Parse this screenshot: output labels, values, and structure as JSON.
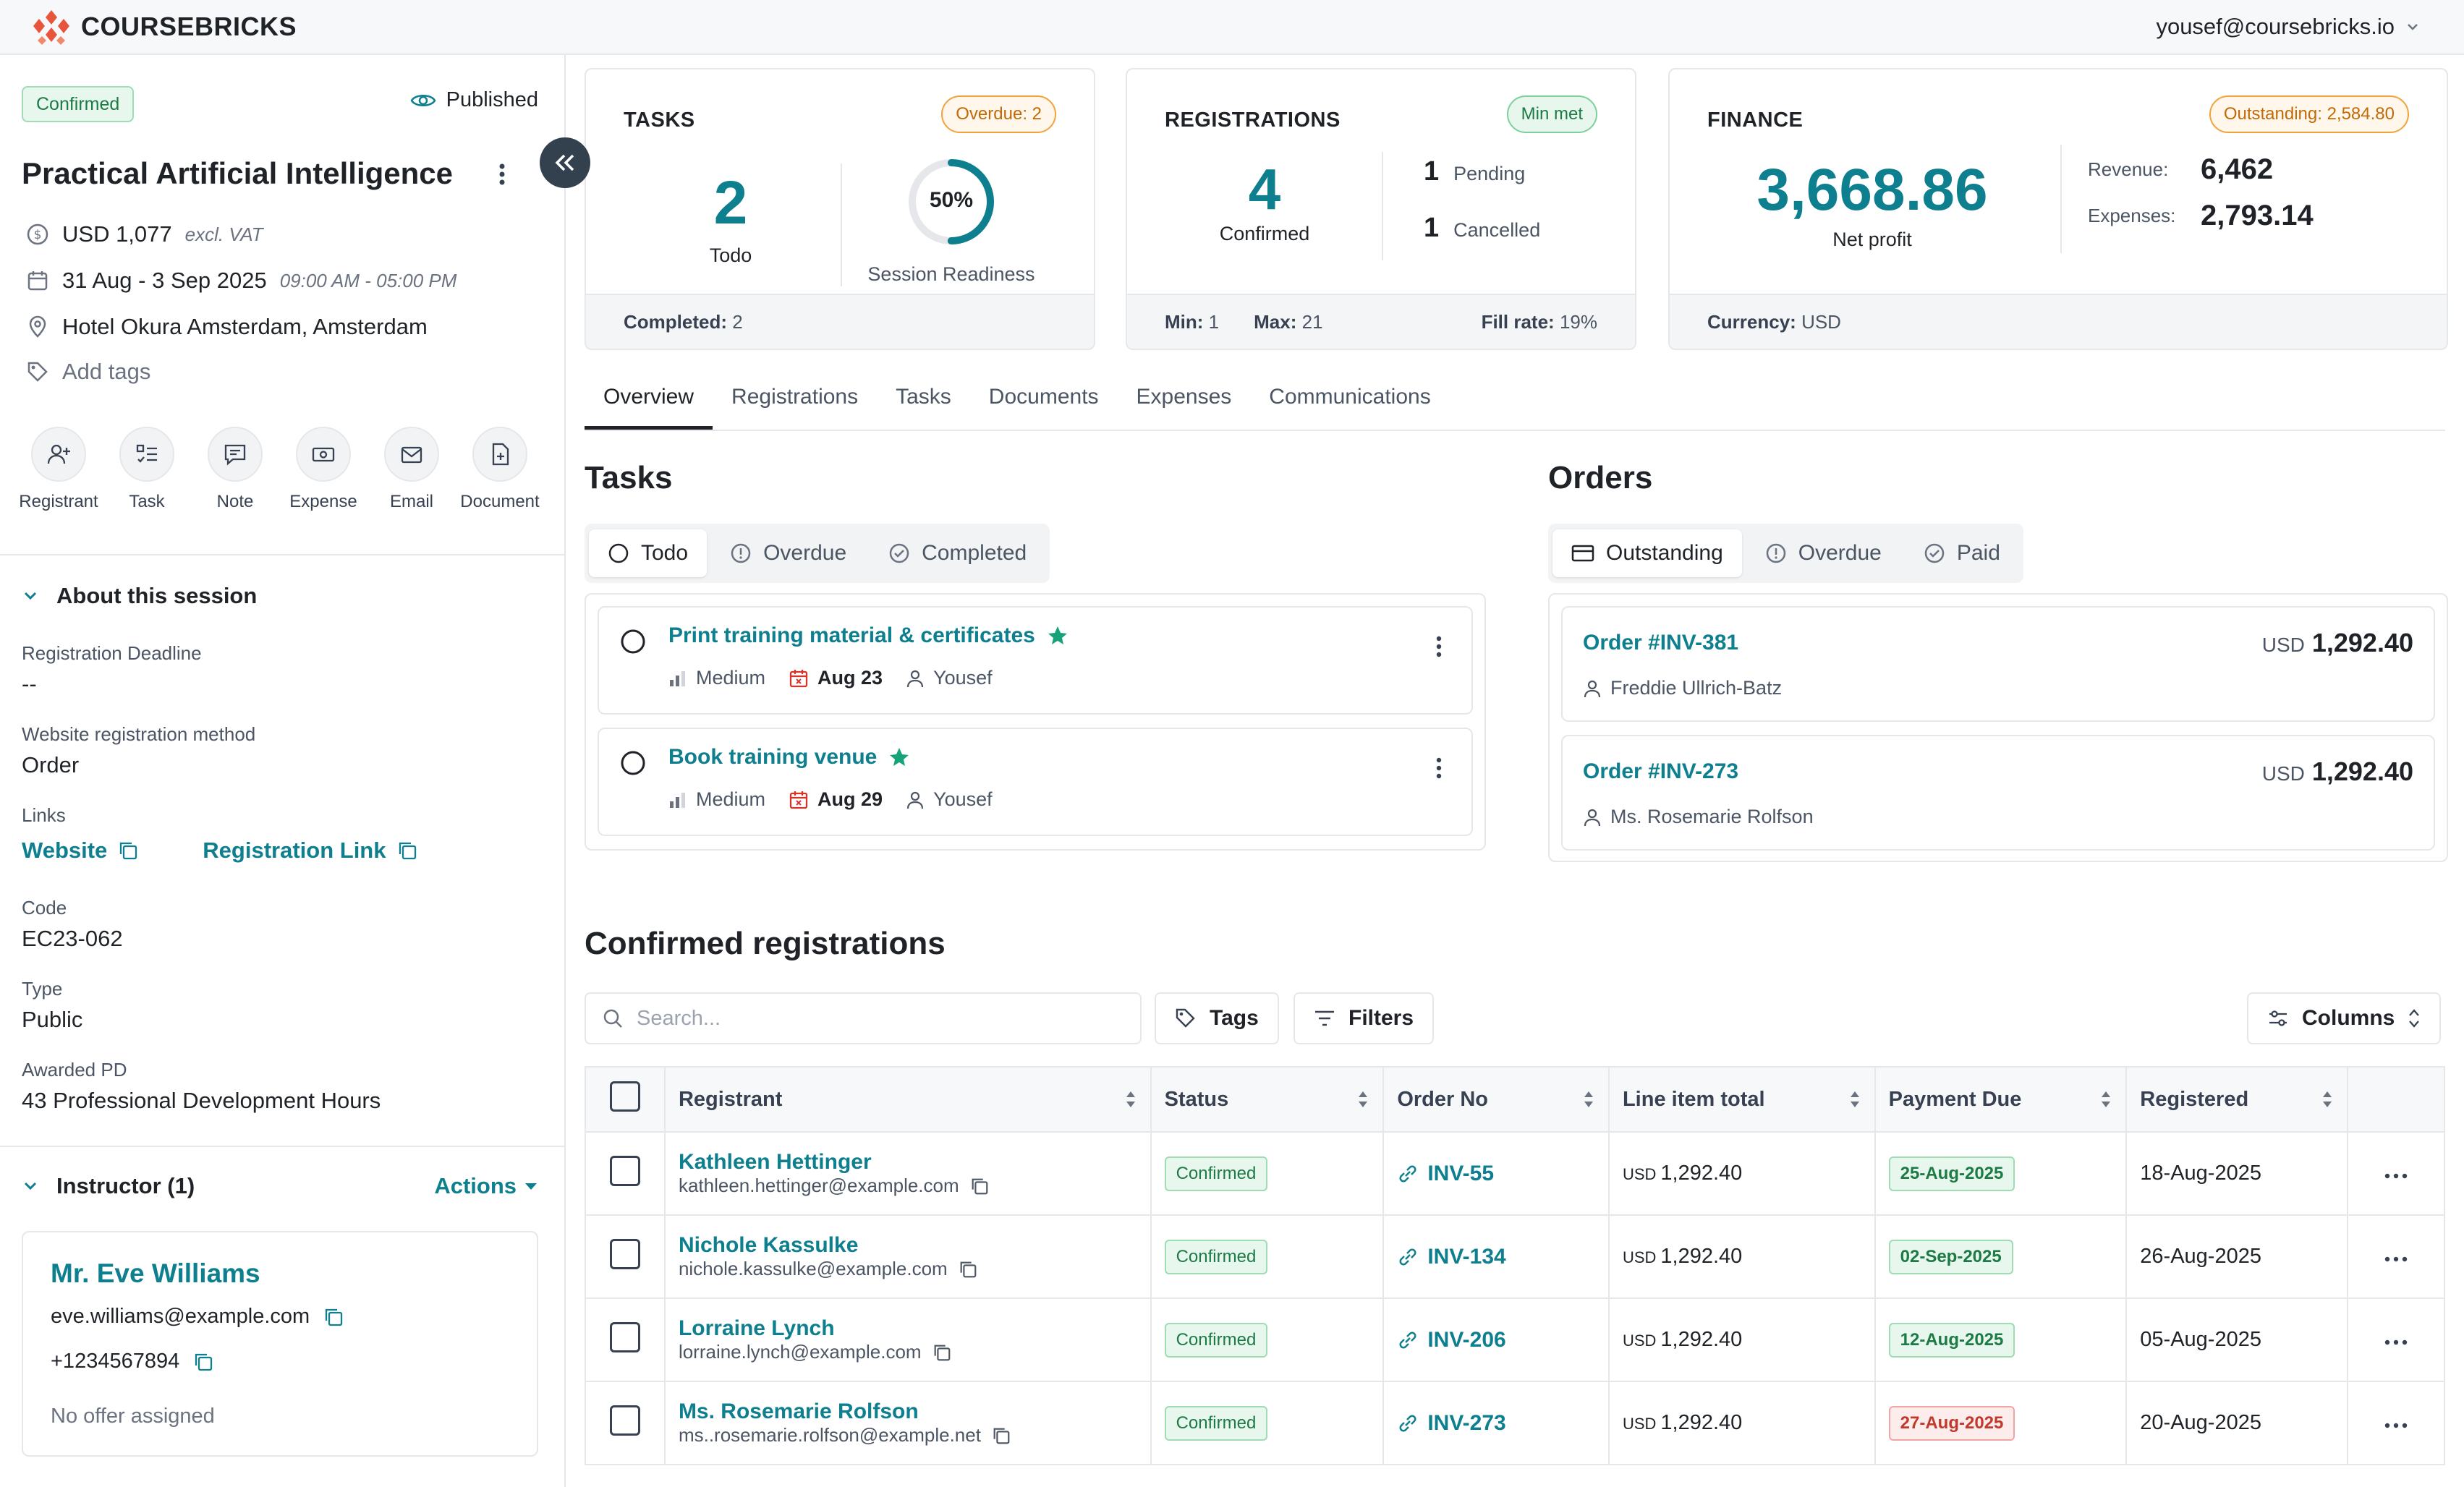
{
  "header": {
    "brand": "COURSEBRICKS",
    "user_email": "yousef@coursebricks.io"
  },
  "session": {
    "status_badge": "Confirmed",
    "published_label": "Published",
    "title": "Practical Artificial Intelligence",
    "price": "USD 1,077",
    "price_note": "excl. VAT",
    "dates": "31 Aug - 3 Sep 2025",
    "times": "09:00 AM - 05:00 PM",
    "location": "Hotel Okura Amsterdam, Amsterdam",
    "add_tags": "Add tags"
  },
  "quick_actions": [
    "Registrant",
    "Task",
    "Note",
    "Expense",
    "Email",
    "Document"
  ],
  "about": {
    "heading": "About this session",
    "deadline_label": "Registration Deadline",
    "deadline_value": "--",
    "method_label": "Website registration method",
    "method_value": "Order",
    "links_label": "Links",
    "link_website": "Website",
    "link_registration": "Registration Link",
    "code_label": "Code",
    "code_value": "EC23-062",
    "type_label": "Type",
    "type_value": "Public",
    "pd_label": "Awarded PD",
    "pd_value": "43 Professional Development Hours"
  },
  "instructor": {
    "heading": "Instructor (1)",
    "actions": "Actions",
    "name": "Mr. Eve Williams",
    "email": "eve.williams@example.com",
    "phone": "+1234567894",
    "note": "No offer assigned"
  },
  "cards": {
    "tasks": {
      "title": "TASKS",
      "pill": "Overdue: 2",
      "todo_count": "2",
      "todo_label": "Todo",
      "readiness_percent": 50,
      "readiness_text": "50%",
      "readiness_label": "Session Readiness",
      "footer_label": "Completed:",
      "footer_value": "2"
    },
    "registrations": {
      "title": "REGISTRATIONS",
      "pill": "Min met",
      "confirmed_count": "4",
      "confirmed_label": "Confirmed",
      "pending_count": "1",
      "pending_label": "Pending",
      "cancelled_count": "1",
      "cancelled_label": "Cancelled",
      "min_label": "Min:",
      "min_value": "1",
      "max_label": "Max:",
      "max_value": "21",
      "fill_label": "Fill rate:",
      "fill_value": "19%"
    },
    "finance": {
      "title": "FINANCE",
      "pill": "Outstanding: 2,584.80",
      "net_profit": "3,668.86",
      "net_profit_label": "Net profit",
      "revenue_label": "Revenue:",
      "revenue_value": "6,462",
      "expenses_label": "Expenses:",
      "expenses_value": "2,793.14",
      "currency_label": "Currency:",
      "currency_value": "USD"
    }
  },
  "tabs": [
    "Overview",
    "Registrations",
    "Tasks",
    "Documents",
    "Expenses",
    "Communications"
  ],
  "tasks_section": {
    "heading": "Tasks",
    "filters": [
      "Todo",
      "Overdue",
      "Completed"
    ],
    "items": [
      {
        "title": "Print training material & certificates",
        "priority": "Medium",
        "due": "Aug 23",
        "assignee": "Yousef"
      },
      {
        "title": "Book training venue",
        "priority": "Medium",
        "due": "Aug 29",
        "assignee": "Yousef"
      }
    ]
  },
  "orders_section": {
    "heading": "Orders",
    "filters": [
      "Outstanding",
      "Overdue",
      "Paid"
    ],
    "items": [
      {
        "order_no": "Order #INV-381",
        "currency": "USD",
        "amount": "1,292.40",
        "person": "Freddie Ullrich-Batz"
      },
      {
        "order_no": "Order #INV-273",
        "currency": "USD",
        "amount": "1,292.40",
        "person": "Ms. Rosemarie Rolfson"
      }
    ]
  },
  "registrations_section": {
    "heading": "Confirmed registrations",
    "search_placeholder": "Search...",
    "tags_btn": "Tags",
    "filters_btn": "Filters",
    "columns_btn": "Columns",
    "columns": [
      "Registrant",
      "Status",
      "Order No",
      "Line item total",
      "Payment Due",
      "Registered"
    ],
    "rows": [
      {
        "name": "Kathleen Hettinger",
        "email": "kathleen.hettinger@example.com",
        "status": "Confirmed",
        "order": "INV-55",
        "currency": "USD",
        "total": "1,292.40",
        "due": "25-Aug-2025",
        "due_state": "green",
        "registered": "18-Aug-2025"
      },
      {
        "name": "Nichole Kassulke",
        "email": "nichole.kassulke@example.com",
        "status": "Confirmed",
        "order": "INV-134",
        "currency": "USD",
        "total": "1,292.40",
        "due": "02-Sep-2025",
        "due_state": "green",
        "registered": "26-Aug-2025"
      },
      {
        "name": "Lorraine Lynch",
        "email": "lorraine.lynch@example.com",
        "status": "Confirmed",
        "order": "INV-206",
        "currency": "USD",
        "total": "1,292.40",
        "due": "12-Aug-2025",
        "due_state": "green",
        "registered": "05-Aug-2025"
      },
      {
        "name": "Ms. Rosemarie Rolfson",
        "email": "ms..rosemarie.rolfson@example.net",
        "status": "Confirmed",
        "order": "INV-273",
        "currency": "USD",
        "total": "1,292.40",
        "due": "27-Aug-2025",
        "due_state": "red",
        "registered": "20-Aug-2025"
      }
    ]
  },
  "colors": {
    "accent": "#0e7f8e",
    "brand": "#e8553d",
    "success": "#1d7a45",
    "warning": "#c26a07",
    "danger": "#c0392b"
  }
}
